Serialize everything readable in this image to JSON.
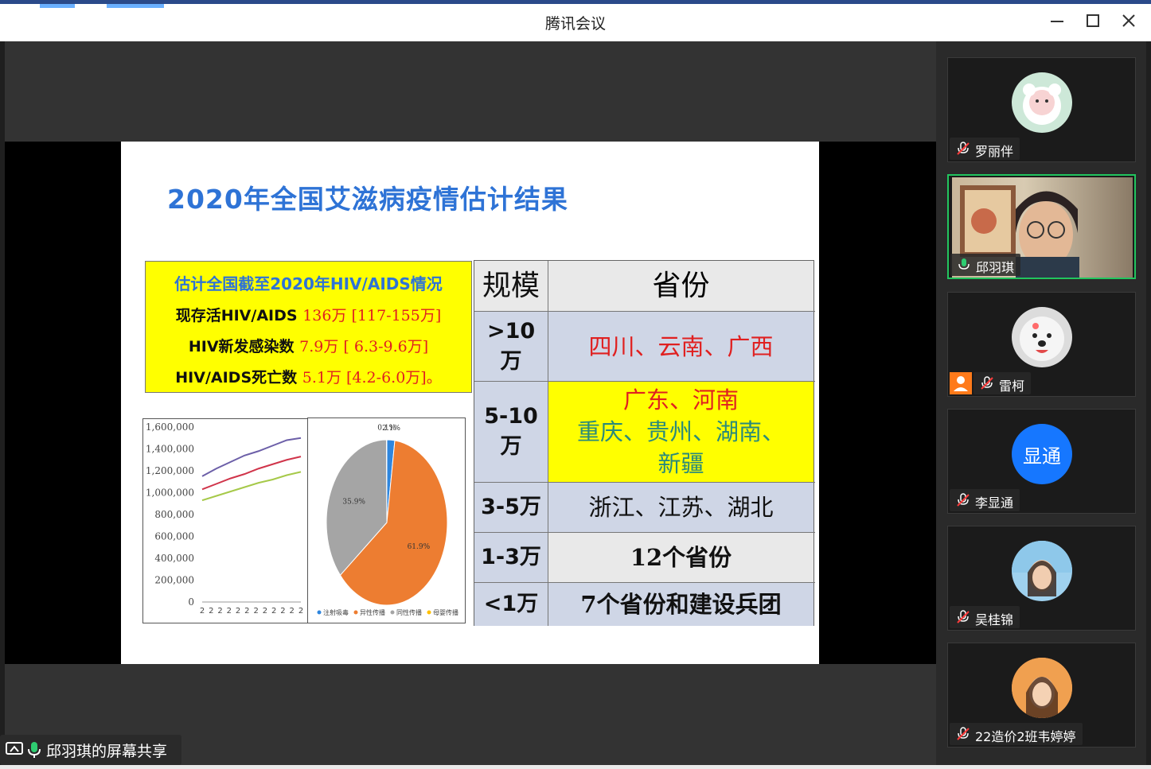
{
  "window": {
    "title": "腾讯会议",
    "controls": [
      "minimize-icon",
      "maximize-icon",
      "close-icon"
    ]
  },
  "slide": {
    "title": "2020年全国艾滋病疫情估计结果",
    "summary_box": {
      "heading": "估计全国截至2020年HIV/AIDS情况",
      "rows": [
        {
          "label": "现存活HIV/AIDS",
          "value": "136万 [117-155万]"
        },
        {
          "label": "HIV新发感染数",
          "value": "7.9万 [ 6.3-9.6万]"
        },
        {
          "label": "HIV/AIDS死亡数",
          "value": "5.1万 [4.2-6.0万]。"
        }
      ]
    },
    "table": {
      "headers": [
        "规模",
        "省份"
      ],
      "rows": [
        {
          "scale": ">10 万",
          "provinces": "四川、云南、广西",
          "color": "#e02020",
          "bg": "#cfd6e6"
        },
        {
          "scale": "5-10 万",
          "provinces_line1": "广东、河南",
          "provinces_line2": "重庆、贵州、湖南、",
          "provinces_line3": "新疆",
          "color1": "#e02020",
          "color2": "#2a8a7a",
          "bg": "#ffff00"
        },
        {
          "scale": "3-5万",
          "provinces": "浙江、江苏、湖北",
          "color": "#111111",
          "bg": "#cfd6e6"
        },
        {
          "scale": "1-3万",
          "provinces": "12个省份",
          "color": "#111111",
          "bg": "#e9e9e9"
        },
        {
          "scale": "<1万",
          "provinces": "7个省份和建设兵团",
          "color": "#111111",
          "bg": "#cfd6e6"
        }
      ]
    }
  },
  "chart_data": [
    {
      "type": "line",
      "y_ticks": [
        "1,600,000",
        "1,400,000",
        "1,200,000",
        "1,000,000",
        "800,000",
        "600,000",
        "400,000",
        "200,000",
        "0"
      ],
      "ylim": [
        0,
        1600000
      ],
      "x_tick_labels": [
        "2",
        "2",
        "2",
        "2",
        "2",
        "2",
        "2",
        "2",
        "2",
        "2",
        "2",
        "2"
      ],
      "series": [
        {
          "color": "#6c5fa8",
          "values": [
            1150000,
            1220000,
            1280000,
            1340000,
            1380000,
            1430000,
            1480000,
            1500000
          ]
        },
        {
          "color": "#d0344a",
          "values": [
            1030000,
            1080000,
            1130000,
            1170000,
            1220000,
            1260000,
            1300000,
            1330000
          ]
        },
        {
          "color": "#a6c949",
          "values": [
            930000,
            970000,
            1010000,
            1050000,
            1090000,
            1120000,
            1160000,
            1190000
          ]
        }
      ]
    },
    {
      "type": "pie",
      "slices": [
        {
          "label": "注射吸毒",
          "value": 2.1,
          "display": "2.1%",
          "color": "#2e86de"
        },
        {
          "label": "异性传播",
          "value": 61.9,
          "display": "61.9%",
          "color": "#ed7d31"
        },
        {
          "label": "同性传播",
          "value": 35.9,
          "display": "35.9%",
          "color": "#a5a5a5"
        },
        {
          "label": "母婴传播",
          "value": 0.1,
          "display": "0.1%",
          "color": "#ffc000"
        }
      ]
    }
  ],
  "share_label": "邱羽琪的屏幕共享",
  "participants": [
    {
      "name": "罗丽伴",
      "muted": true,
      "avatar": "sheep-avatar"
    },
    {
      "name": "邱羽琪",
      "muted": false,
      "avatar": "video-feed",
      "active": true
    },
    {
      "name": "雷柯",
      "muted": true,
      "avatar": "dog-avatar",
      "host_badge": true
    },
    {
      "name": "李显通",
      "muted": true,
      "avatar": "initials-avatar",
      "initials": "显通"
    },
    {
      "name": "吴桂锦",
      "muted": true,
      "avatar": "girl-avatar"
    },
    {
      "name": "22造价2班韦婷婷",
      "muted": true,
      "avatar": "sunset-avatar"
    }
  ]
}
